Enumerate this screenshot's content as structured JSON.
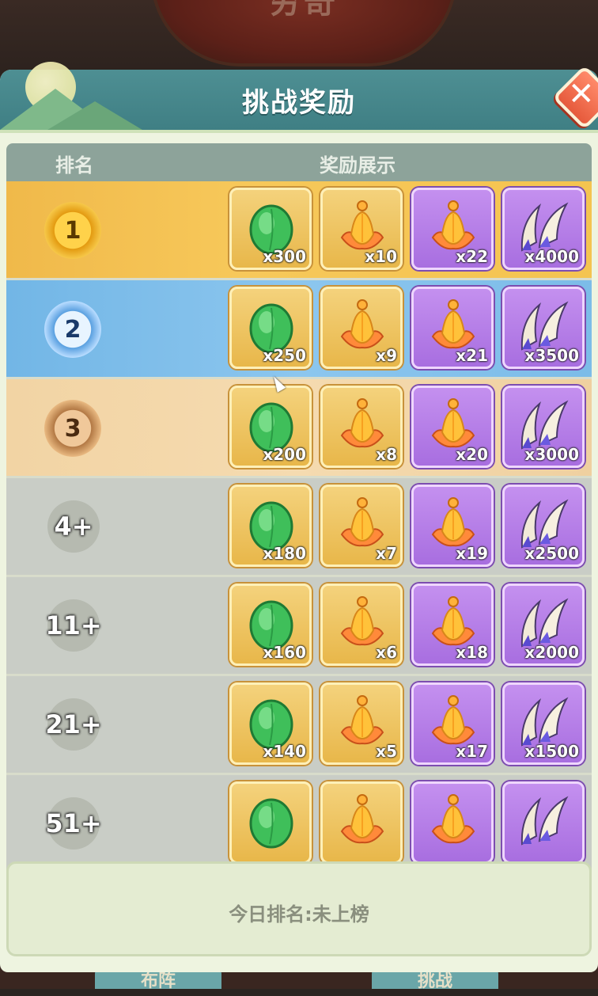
{
  "background": {
    "banner_text": "穷奇",
    "bottom_buttons": [
      "布阵",
      "挑战"
    ]
  },
  "modal": {
    "title": "挑战奖励",
    "close_icon": "close-icon"
  },
  "table": {
    "headers": {
      "rank": "排名",
      "rewards": "奖励展示"
    },
    "item_types": [
      {
        "icon": "green-leaf-icon",
        "frame": "gold"
      },
      {
        "icon": "golden-lotus-icon",
        "frame": "gold"
      },
      {
        "icon": "golden-lotus-icon",
        "frame": "purple"
      },
      {
        "icon": "claw-fang-icon",
        "frame": "purple"
      }
    ],
    "rows": [
      {
        "rank": "1",
        "style": "gold",
        "qty": [
          "x300",
          "x10",
          "x22",
          "x4000"
        ]
      },
      {
        "rank": "2",
        "style": "blue",
        "qty": [
          "x250",
          "x9",
          "x21",
          "x3500"
        ]
      },
      {
        "rank": "3",
        "style": "bronze",
        "qty": [
          "x200",
          "x8",
          "x20",
          "x3000"
        ]
      },
      {
        "rank": "4+",
        "style": "grey",
        "qty": [
          "x180",
          "x7",
          "x19",
          "x2500"
        ]
      },
      {
        "rank": "11+",
        "style": "grey",
        "qty": [
          "x160",
          "x6",
          "x18",
          "x2000"
        ]
      },
      {
        "rank": "21+",
        "style": "grey",
        "qty": [
          "x140",
          "x5",
          "x17",
          "x1500"
        ]
      },
      {
        "rank": "51+",
        "style": "grey",
        "qty": [
          "",
          "",
          "",
          ""
        ]
      }
    ]
  },
  "status": {
    "today_rank": "今日排名:未上榜"
  },
  "colors": {
    "header_teal": "#4e8f93",
    "rank1_gold": "#f0b94a",
    "rank2_blue": "#72b6e6",
    "rank3_bronze": "#f2d4a4",
    "item_gold": "#e8b74a",
    "item_purple": "#a86ee0"
  }
}
